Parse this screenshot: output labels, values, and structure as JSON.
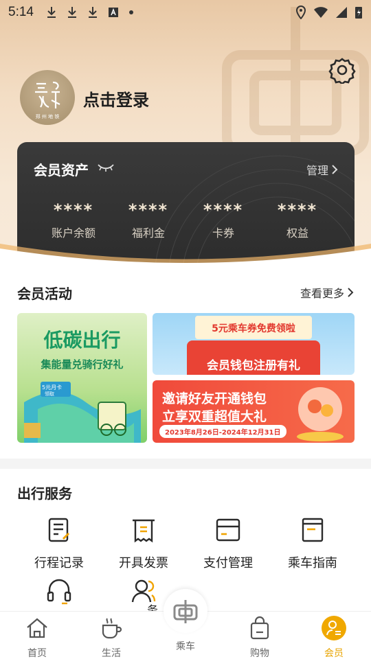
{
  "status_bar": {
    "time": "5:14"
  },
  "profile": {
    "login_text": "点击登录",
    "avatar_caption": "郑 州 地 铁"
  },
  "assets": {
    "title": "会员资产",
    "manage_label": "管理",
    "items": [
      {
        "value": "****",
        "label": "账户余额"
      },
      {
        "value": "****",
        "label": "福利金"
      },
      {
        "value": "****",
        "label": "卡券"
      },
      {
        "value": "****",
        "label": "权益"
      }
    ]
  },
  "activity": {
    "title": "会员活动",
    "more_label": "查看更多",
    "banners": [
      {
        "line1": "低碳出行",
        "line2": "集能量兑骑行好礼",
        "tag": "5元月卡",
        "tag2": "领取"
      },
      {
        "line1": "5元乘车券免费领啦",
        "line2": "会员钱包注册有礼"
      },
      {
        "line1": "邀请好友开通钱包",
        "line2": "立享双重超值大礼",
        "date": "2023年8月26日-2024年12月31日"
      }
    ]
  },
  "service": {
    "title": "出行服务",
    "items": [
      {
        "label": "行程记录",
        "icon": "trip-record-icon"
      },
      {
        "label": "开具发票",
        "icon": "invoice-icon"
      },
      {
        "label": "支付管理",
        "icon": "payment-card-icon"
      },
      {
        "label": "乘车指南",
        "icon": "guide-icon"
      },
      {
        "label": "",
        "icon": "headset-icon"
      },
      {
        "label": "",
        "icon": "users-icon"
      }
    ],
    "partial_label": "务"
  },
  "tabbar": {
    "tabs": [
      {
        "label": "首页",
        "icon": "home-icon"
      },
      {
        "label": "生活",
        "icon": "coffee-icon"
      },
      {
        "label": "乘车",
        "icon": "metro-logo-icon"
      },
      {
        "label": "购物",
        "icon": "shopping-bag-icon"
      },
      {
        "label": "会员",
        "icon": "member-icon"
      }
    ],
    "active": "会员"
  },
  "colors": {
    "accent": "#e8a400",
    "card": "#2f2f2f",
    "gold_text": "#f1e5d2"
  }
}
